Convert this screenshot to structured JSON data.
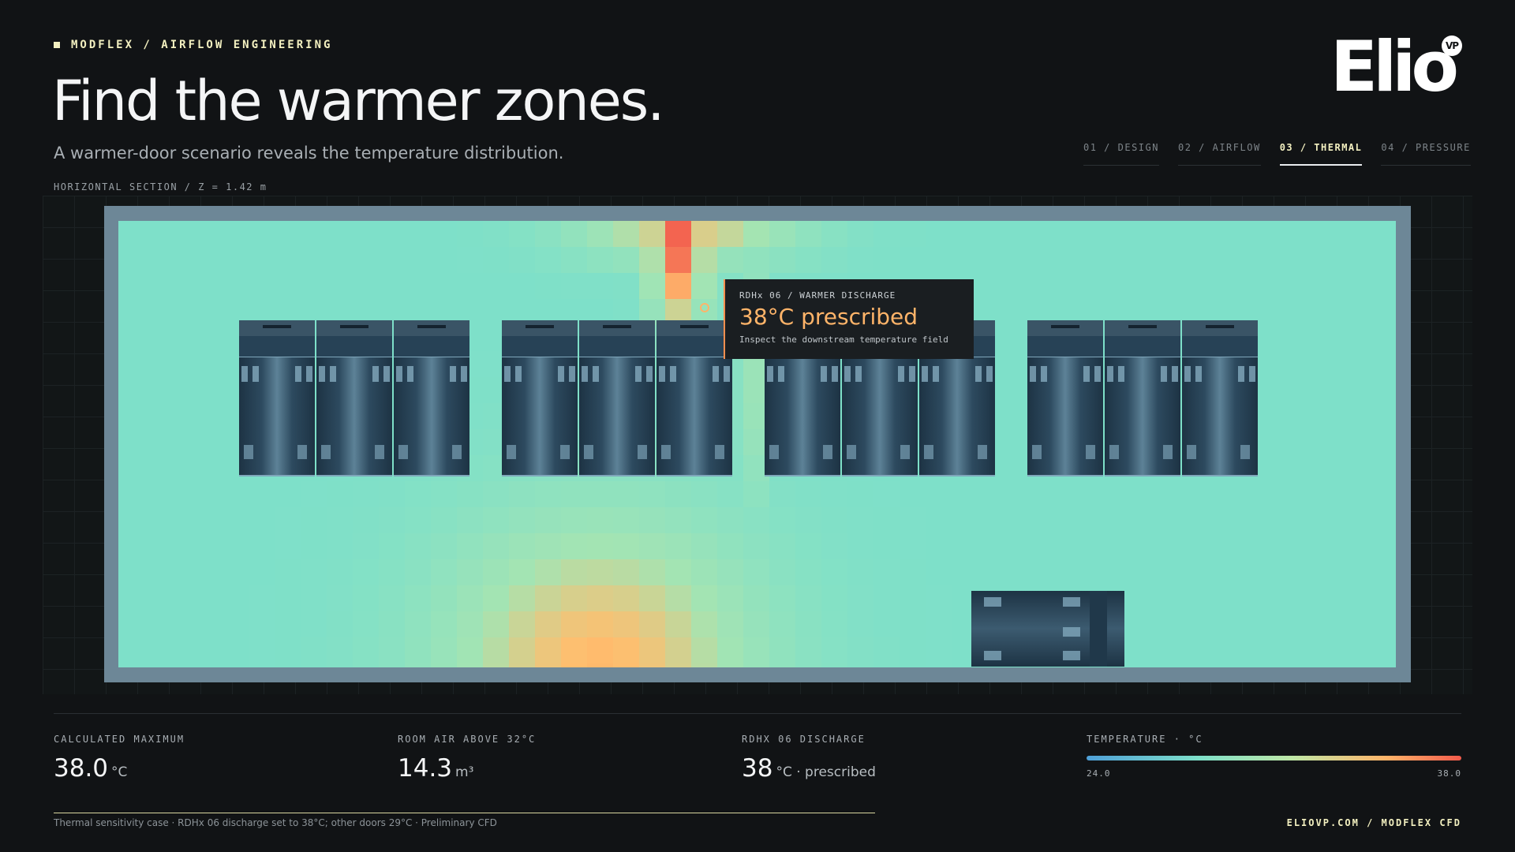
{
  "header": {
    "eyebrow": "MODFLEX / AIRFLOW ENGINEERING",
    "title": "Find the warmer zones.",
    "subtitle": "A warmer-door scenario reveals the temperature distribution.",
    "section_label": "HORIZONTAL SECTION / Z = 1.42 m"
  },
  "logo": {
    "text": "Elio",
    "badge": "VP"
  },
  "tabs": [
    {
      "label": "01 / DESIGN",
      "active": false
    },
    {
      "label": "02 / AIRFLOW",
      "active": false
    },
    {
      "label": "03 / THERMAL",
      "active": true
    },
    {
      "label": "04 / PRESSURE",
      "active": false
    }
  ],
  "colors": {
    "accent": "#f3f0c0",
    "hot": "#f35b4b",
    "warm": "#ffb469",
    "cool": "#7ee0c9",
    "cold": "#4fa0d8"
  },
  "callout": {
    "tag": "RDHx 06 / WARMER DISCHARGE",
    "value": "38°C prescribed",
    "desc": "Inspect the downstream temperature field"
  },
  "stats": [
    {
      "label": "CALCULATED MAXIMUM",
      "value": "38.0",
      "unit": "°C"
    },
    {
      "label": "ROOM AIR ABOVE 32°C",
      "value": "14.3",
      "unit": "m³"
    },
    {
      "label": "RDHX 06 DISCHARGE",
      "value": "38",
      "unit": "°C · prescribed"
    }
  ],
  "scale": {
    "label": "TEMPERATURE · °C",
    "min": "24.0",
    "max": "38.0"
  },
  "footer": {
    "note": "Thermal sensitivity case · RDHx 06 discharge set to 38°C; other doors 29°C · Preliminary CFD",
    "right": "ELIOVP.COM / MODFLEX CFD"
  }
}
